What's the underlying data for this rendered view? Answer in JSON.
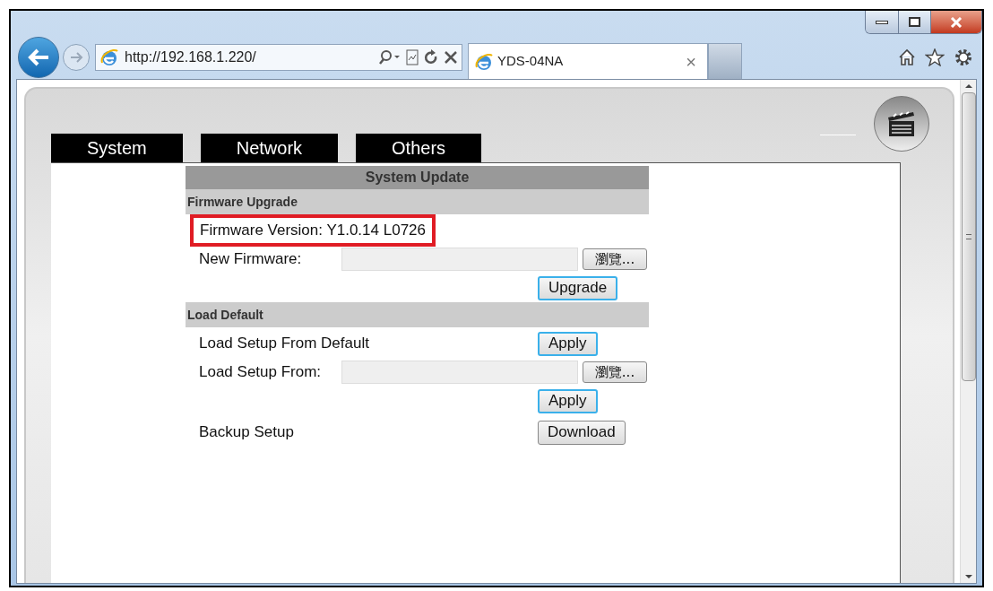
{
  "browser": {
    "address": "http://192.168.1.220/",
    "tab_title": "YDS-04NA",
    "tab_close": "×"
  },
  "page": {
    "tabs": [
      {
        "label": "System",
        "selected": false
      },
      {
        "label": "Network",
        "selected": false
      },
      {
        "label": "Others",
        "selected": false
      }
    ],
    "panel_title": "System Update",
    "sections": [
      {
        "title": "Firmware Upgrade",
        "rows": [
          {
            "kind": "info",
            "label": "Firmware Version: Y1.0.14 L0726",
            "highlighted": true
          },
          {
            "kind": "file",
            "label": "New Firmware:",
            "browse": "瀏覽..."
          },
          {
            "kind": "button",
            "button": "Upgrade",
            "focused": true
          }
        ]
      },
      {
        "title": "Load Default",
        "rows": [
          {
            "kind": "action",
            "label": "Load Setup From Default",
            "button": "Apply",
            "focused": true
          },
          {
            "kind": "file",
            "label": "Load Setup From:",
            "browse": "瀏覽..."
          },
          {
            "kind": "button",
            "button": "Apply",
            "focused": true
          },
          {
            "kind": "action",
            "label": "Backup Setup",
            "button": "Download",
            "focused": false
          }
        ]
      }
    ]
  }
}
